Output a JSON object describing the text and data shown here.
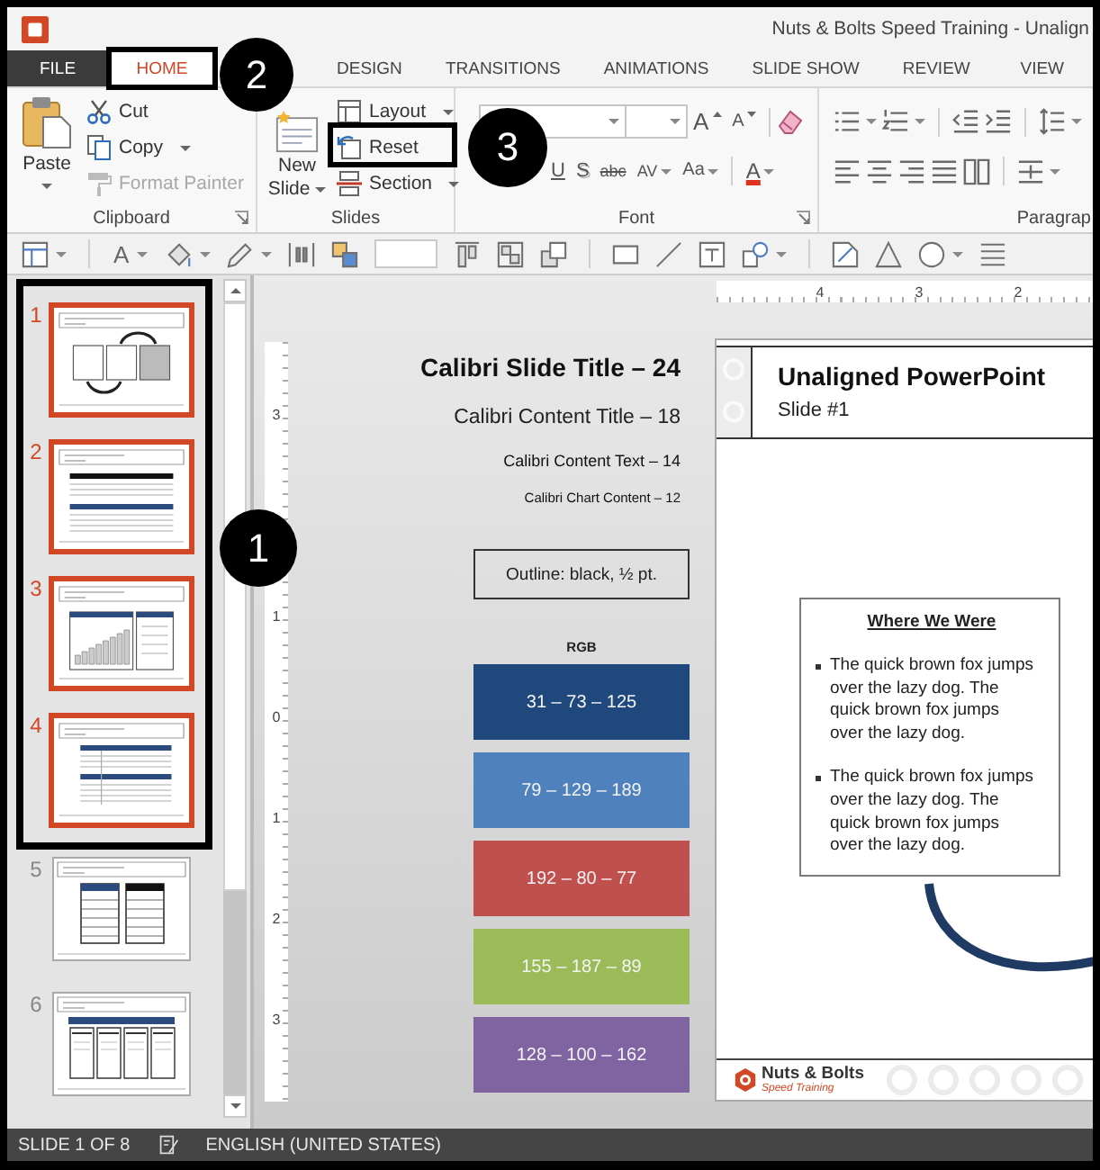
{
  "window": {
    "title": "Nuts & Bolts Speed Training - Unalign"
  },
  "tabs": [
    {
      "label": "FILE",
      "kind": "file",
      "selected": false,
      "framed": false
    },
    {
      "label": "HOME",
      "kind": "tab",
      "selected": true,
      "framed": true,
      "callout": "2"
    },
    {
      "label": "DESIGN",
      "kind": "tab",
      "selected": false,
      "framed": false
    },
    {
      "label": "TRANSITIONS",
      "kind": "tab",
      "selected": false,
      "framed": false
    },
    {
      "label": "ANIMATIONS",
      "kind": "tab",
      "selected": false,
      "framed": false
    },
    {
      "label": "SLIDE SHOW",
      "kind": "tab",
      "selected": false,
      "framed": false
    },
    {
      "label": "REVIEW",
      "kind": "tab",
      "selected": false,
      "framed": false
    },
    {
      "label": "VIEW",
      "kind": "tab",
      "selected": false,
      "framed": false
    }
  ],
  "ribbon": {
    "clipboard": {
      "label": "Clipboard",
      "launcher": true,
      "paste": "Paste",
      "items": [
        {
          "label": "Cut",
          "kind": "cut",
          "dropdown": false,
          "disabled": false
        },
        {
          "label": "Copy",
          "kind": "copy",
          "dropdown": true,
          "disabled": false
        },
        {
          "label": "Format Painter",
          "kind": "painter",
          "dropdown": false,
          "disabled": true
        }
      ]
    },
    "slides": {
      "label": "Slides",
      "new_slide": "New Slide",
      "items": [
        {
          "label": "Layout",
          "kind": "layout",
          "dropdown": true,
          "framed": false
        },
        {
          "label": "Reset",
          "kind": "reset",
          "dropdown": false,
          "framed": true,
          "callout": "3"
        },
        {
          "label": "Section",
          "kind": "section",
          "dropdown": true,
          "framed": false
        }
      ]
    },
    "font": {
      "label": "Font",
      "launcher": true,
      "row_1": [
        {
          "label": "A",
          "kind": "grow"
        },
        {
          "label": "A",
          "kind": "shrink"
        }
      ],
      "row_2": [
        {
          "label": "U",
          "kind": "underline"
        },
        {
          "label": "S",
          "kind": "shadow"
        },
        {
          "label": "abc",
          "kind": "strike"
        },
        {
          "label": "AV",
          "kind": "spacing"
        },
        {
          "label": "Aa",
          "kind": "case"
        },
        {
          "label": "A",
          "kind": "color"
        }
      ]
    },
    "paragraph": {
      "label": "Paragrap"
    }
  },
  "toolbar": {
    "font_color_button": "A"
  },
  "slide_pane": {
    "callout": "1",
    "slides": [
      {
        "number": "1",
        "kind": "diagram",
        "selected": true,
        "framed": true
      },
      {
        "number": "2",
        "kind": "grid",
        "selected": true,
        "framed": true
      },
      {
        "number": "3",
        "kind": "chart",
        "selected": true,
        "framed": true
      },
      {
        "number": "4",
        "kind": "list",
        "selected": true,
        "framed": true
      },
      {
        "number": "5",
        "kind": "split",
        "selected": false,
        "framed": false
      },
      {
        "number": "6",
        "kind": "cards",
        "selected": false,
        "framed": false
      }
    ]
  },
  "canvas": {
    "h_ruler": [
      "4",
      "3",
      "2"
    ],
    "v_ruler": [
      "3",
      "1",
      "0",
      "1",
      "2",
      "3"
    ],
    "notes": [
      {
        "text": "Calibri Slide Title – 24",
        "kind": "title"
      },
      {
        "text": "Calibri Content Title – 18",
        "kind": "subtitle"
      },
      {
        "text": "Calibri Content Text – 14",
        "kind": "text"
      },
      {
        "text": "Calibri Chart Content – 12",
        "kind": "chart"
      }
    ],
    "outline_sample": "Outline: black, ½ pt.",
    "rgb_label": "RGB",
    "swatches": [
      {
        "label": "31 – 73 – 125",
        "color": "#1f497d"
      },
      {
        "label": "79 – 129 – 189",
        "color": "#4f81bd"
      },
      {
        "label": "192 – 80 – 77",
        "color": "#c0504d"
      },
      {
        "label": "155 – 187 – 89",
        "color": "#9bbb59"
      },
      {
        "label": "128 – 100 – 162",
        "color": "#8064a2"
      }
    ],
    "slide": {
      "title": "Unaligned PowerPoint",
      "subtitle": "Slide #1",
      "box": {
        "heading": "Where We Were",
        "bullets": [
          "The quick brown fox jumps over the lazy dog. The quick brown fox jumps over the lazy dog.",
          "The quick brown fox jumps over the lazy dog. The quick brown fox jumps over the lazy dog."
        ]
      },
      "logo": {
        "name": "Nuts & Bolts",
        "tagline": "Speed Training"
      }
    }
  },
  "status_bar": {
    "slide_info": "SLIDE 1 OF 8",
    "language": "ENGLISH (UNITED STATES)"
  }
}
